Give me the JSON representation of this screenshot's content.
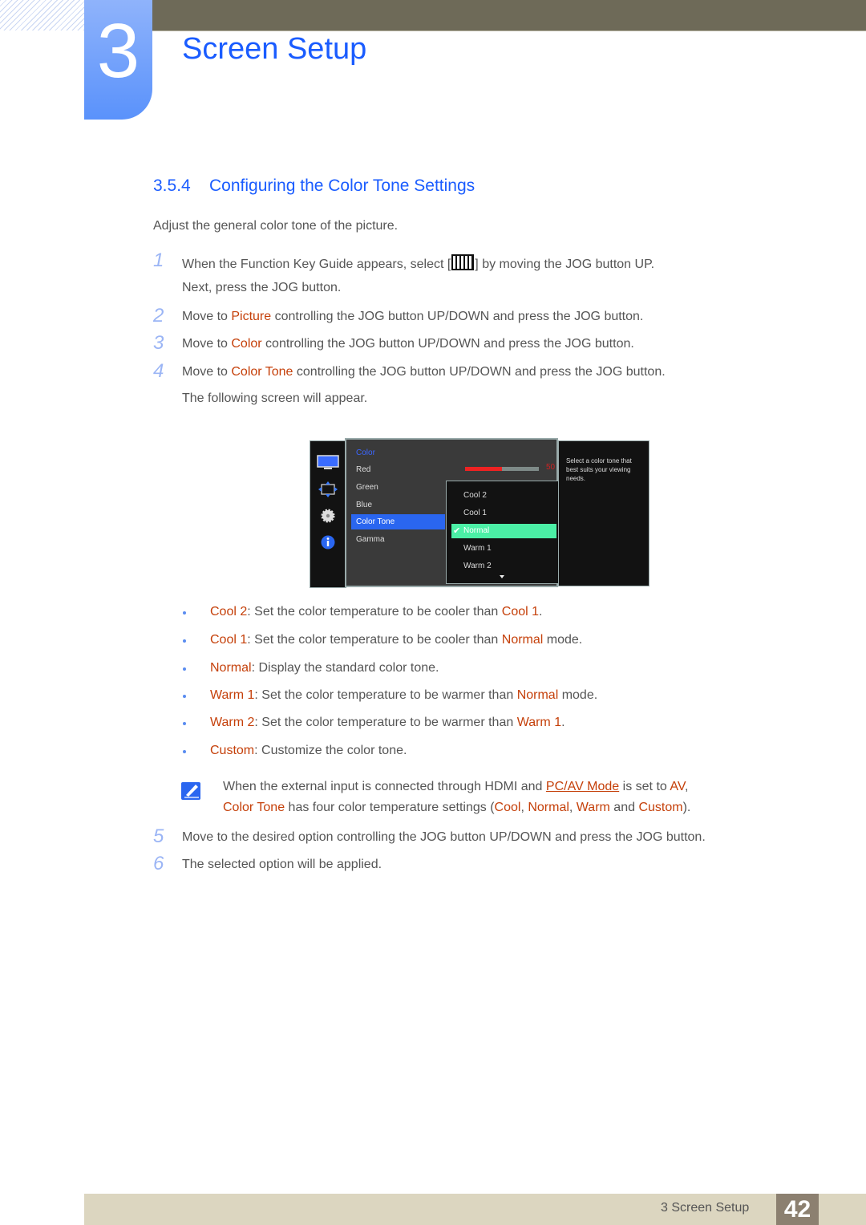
{
  "chapter": {
    "number": "3",
    "title": "Screen Setup"
  },
  "section": {
    "number": "3.5.4",
    "title": "Configuring the Color Tone Settings"
  },
  "intro": "Adjust the general color tone of the picture.",
  "steps": [
    {
      "n": "1",
      "pre": "When the Function Key Guide appears, select [",
      "icon": "menu-key-icon",
      "post": "] by moving the JOG button UP.",
      "line2": "Next, press the JOG button."
    },
    {
      "n": "2",
      "pre": "Move to ",
      "hl": "Picture",
      "post": " controlling the JOG button UP/DOWN and press the JOG button."
    },
    {
      "n": "3",
      "pre": "Move to ",
      "hl": "Color",
      "post": " controlling the JOG button UP/DOWN and press the JOG button."
    },
    {
      "n": "4",
      "pre": "Move to ",
      "hl": "Color Tone",
      "post": " controlling the JOG button UP/DOWN and press the JOG button.",
      "line2": "The following screen will appear."
    },
    {
      "n": "5",
      "text": "Move to the desired option controlling the JOG button UP/DOWN and press the JOG button."
    },
    {
      "n": "6",
      "text": "The selected option will be applied."
    }
  ],
  "osd": {
    "side_icons": [
      "monitor-icon",
      "resize-arrows-icon",
      "gear-icon",
      "info-icon"
    ],
    "category": "Color",
    "items": [
      "Red",
      "Green",
      "Blue",
      "Color Tone",
      "Gamma"
    ],
    "selected_item": "Color Tone",
    "slider": {
      "label": "Red",
      "value": "50",
      "fraction": 0.5
    },
    "dropdown": {
      "options": [
        "Cool 2",
        "Cool 1",
        "Normal",
        "Warm 1",
        "Warm 2"
      ],
      "selected": "Normal",
      "check": "✔"
    },
    "help_text": "Select a color tone that best suits your viewing needs.",
    "colors": {
      "highlight_blue": "#2a66f0",
      "highlight_green": "#4bf0a6",
      "slider_red": "#ee2222"
    }
  },
  "bullets": [
    {
      "term": "Cool 2",
      "text": ": Set the color temperature to be cooler than ",
      "ref": "Cool 1",
      "tail": "."
    },
    {
      "term": "Cool 1",
      "text": ": Set the color temperature to be cooler than ",
      "ref": "Normal",
      "tail": " mode."
    },
    {
      "term": "Normal",
      "text": ": Display the standard color tone.",
      "ref": "",
      "tail": ""
    },
    {
      "term": "Warm 1",
      "text": ": Set the color temperature to be warmer than ",
      "ref": "Normal",
      "tail": " mode."
    },
    {
      "term": "Warm 2",
      "text": ": Set the color temperature to be warmer than ",
      "ref": "Warm 1",
      "tail": "."
    },
    {
      "term": "Custom",
      "text": ": Customize the color tone.",
      "ref": "",
      "tail": ""
    }
  ],
  "note": {
    "line1": {
      "a": "When the external input is connected through HDMI and ",
      "link": "PC/AV Mode",
      "b": " is set to ",
      "c": "AV",
      "d": ","
    },
    "line2": {
      "a": "Color Tone",
      "b": " has four color temperature settings (",
      "c": "Cool",
      "d": ", ",
      "e": "Normal",
      "f": ", ",
      "g": "Warm",
      "h": " and ",
      "i": "Custom",
      "j": ")."
    }
  },
  "footer": {
    "text": "3 Screen Setup",
    "page": "42"
  },
  "colors": {
    "accent_blue": "#1a5cff",
    "highlight_orange": "#c5400a",
    "topbar": "#6e6a58",
    "footer": "#dcd6c0",
    "page_box": "#8c8070"
  }
}
